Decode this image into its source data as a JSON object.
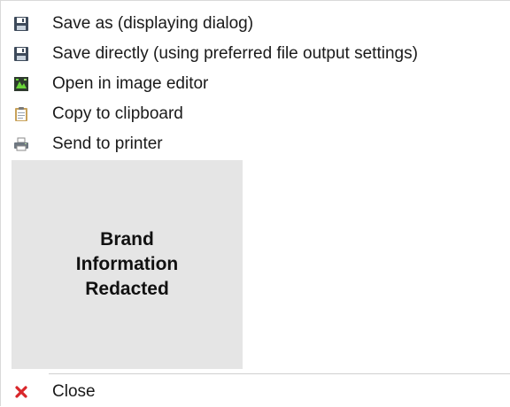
{
  "menu": {
    "items": [
      {
        "label": "Save as (displaying dialog)",
        "icon": "floppy-disk-icon"
      },
      {
        "label": "Save directly (using preferred file output settings)",
        "icon": "floppy-disk-icon"
      },
      {
        "label": "Open in image editor",
        "icon": "image-editor-icon"
      },
      {
        "label": "Copy to clipboard",
        "icon": "clipboard-icon"
      },
      {
        "label": "Send to printer",
        "icon": "printer-icon"
      }
    ],
    "brand_placeholder": "Brand\nInformation\nRedacted",
    "close": {
      "label": "Close",
      "icon": "close-icon"
    }
  },
  "colors": {
    "close_icon": "#d9262a",
    "brand_box": "#e5e5e5",
    "editor_icon_bg": "#2e3a2e",
    "editor_icon_fg": "#6ad63a"
  }
}
